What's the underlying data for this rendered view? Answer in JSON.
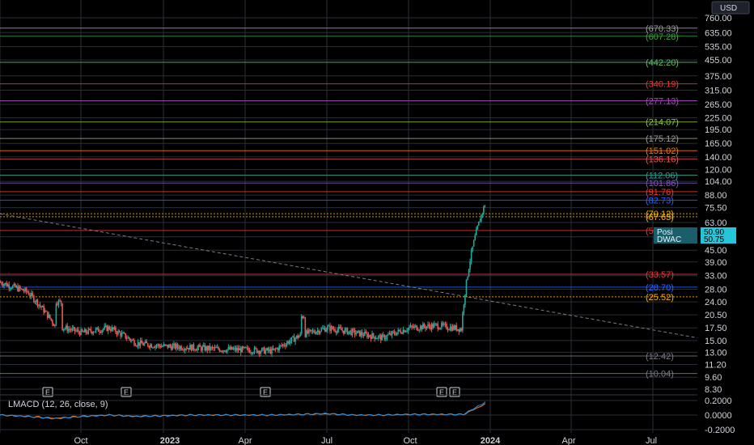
{
  "currency_label": "USD",
  "colors": {
    "background": "#000000",
    "grid": "#2a2e39",
    "candle_up": "#26a69a",
    "candle_down": "#ef5350",
    "axis_text": "#d1d4dc",
    "price_tag_cyan": "#26c6da",
    "price_tag_blue": "#2962ff",
    "dashed_trend": "#787b86",
    "macd_line": "#2196f3",
    "signal_line": "#ff6d00"
  },
  "price_axis": {
    "scale": "log",
    "ticks": [
      "760.00",
      "635.00",
      "535.00",
      "455.00",
      "375.00",
      "315.00",
      "265.00",
      "225.00",
      "195.00",
      "165.00",
      "140.00",
      "120.00",
      "104.00",
      "88.00",
      "75.50",
      "63.00",
      "53.00",
      "45.00",
      "39.00",
      "33.00",
      "28.00",
      "24.00",
      "20.50",
      "17.50",
      "15.00",
      "13.00",
      "11.20",
      "9.60",
      "8.30"
    ]
  },
  "macd_axis": {
    "ticks": [
      "0.2000",
      "0.0000",
      "-0.2000"
    ]
  },
  "time_axis": {
    "labels": [
      "Oct",
      "2023",
      "Apr",
      "Jul",
      "Oct",
      "2024",
      "Apr",
      "Jul"
    ]
  },
  "level_labels": [
    "(670.33)",
    "(607.28)",
    "(442.20)",
    "(340.19)",
    "(277.13)",
    "(214.07)",
    "(175.12)",
    "(151.02)",
    "(136.16)",
    "(112.06)",
    "(101.86)",
    "(91.76)",
    "(82.73)",
    "(70.12)",
    "(67.63)",
    "(57.16)",
    "(33.57)",
    "(28.70)",
    "(25.52)",
    "(12.42)",
    "(10.04)"
  ],
  "price_tags": [
    {
      "name": "Posi",
      "value": "50.90"
    },
    {
      "name": "DWAC",
      "value": "50.75"
    }
  ],
  "earnings_markers": [
    "E",
    "E",
    "E",
    "E",
    "E"
  ],
  "indicator_title": "LMACD (12, 26, close, 9)",
  "chart_data": {
    "type": "candlestick",
    "symbol": "DWAC",
    "y_scale": "log",
    "x": [
      "2022-08",
      "2022-09",
      "2022-10",
      "2022-11",
      "2022-12",
      "2023-01",
      "2023-02",
      "2023-03",
      "2023-04",
      "2023-05",
      "2023-06",
      "2023-07",
      "2023-08",
      "2023-09",
      "2023-10",
      "2023-11",
      "2023-12",
      "2024-01",
      "2024-02"
    ],
    "close": [
      30.5,
      27.0,
      18.0,
      16.5,
      17.5,
      14.5,
      14.0,
      13.8,
      13.5,
      13.4,
      13.2,
      16.0,
      17.5,
      16.5,
      15.5,
      17.5,
      18.0,
      17.2,
      50.75
    ],
    "levels": [
      670.33,
      607.28,
      442.2,
      340.19,
      277.13,
      214.07,
      175.12,
      151.02,
      136.16,
      112.06,
      101.86,
      91.76,
      82.73,
      70.12,
      67.63,
      57.16,
      33.57,
      28.7,
      25.52,
      12.42,
      10.04
    ],
    "last_price": 50.75,
    "position_price": 50.9,
    "indicator": {
      "name": "LMACD (12, 26, close, 9)",
      "macd": [
        0.0,
        -0.02,
        -0.05,
        -0.02,
        0.0,
        -0.02,
        -0.01,
        0.0,
        0.0,
        0.0,
        0.0,
        0.01,
        0.02,
        0.0,
        0.0,
        0.01,
        0.01,
        0.01,
        0.22
      ],
      "ylim": [
        -0.2,
        0.2
      ]
    }
  }
}
